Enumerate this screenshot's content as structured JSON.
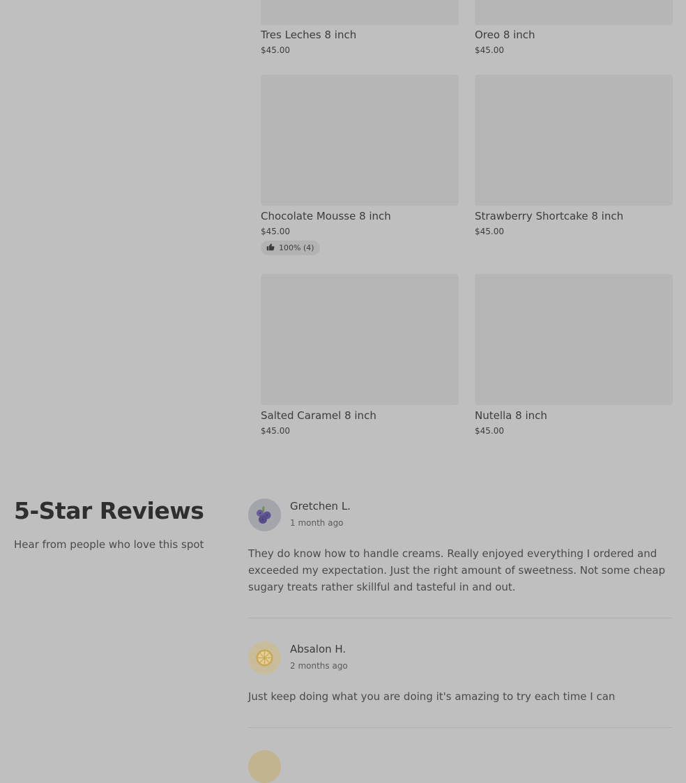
{
  "products": [
    {
      "name": "Tres Leches 8 inch",
      "price": "$45.00"
    },
    {
      "name": "Oreo 8 inch",
      "price": "$45.00"
    },
    {
      "name": "Chocolate Mousse 8 inch",
      "price": "$45.00",
      "rating": "100% (4)"
    },
    {
      "name": "Strawberry Shortcake 8 inch",
      "price": "$45.00"
    },
    {
      "name": "Salted Caramel 8 inch",
      "price": "$45.00"
    },
    {
      "name": "Nutella 8 inch",
      "price": "$45.00"
    }
  ],
  "reviews_section": {
    "title": "5-Star Reviews",
    "subtitle": "Hear from people who love this spot",
    "reviews": [
      {
        "name": "Gretchen L.",
        "date": "1 month ago",
        "text": "They do know how to handle creams. Really enjoyed everything I ordered and exceeded my expectation. Just the right amount of sweetness. Not some cheap sugary treats rather skillful and tasteful in and out.",
        "avatar_icon": "blueberry-icon",
        "avatar_color": "#a4a4ab"
      },
      {
        "name": "Absalon H.",
        "date": "2 months ago",
        "text": "Just keep doing what you are doing it's amazing to try each time I can",
        "avatar_icon": "lemon-icon",
        "avatar_color": "#c8bc9a"
      }
    ]
  },
  "colors": {
    "overlay_background": "#bfbfbf",
    "image_placeholder": "#b6b6b6"
  }
}
